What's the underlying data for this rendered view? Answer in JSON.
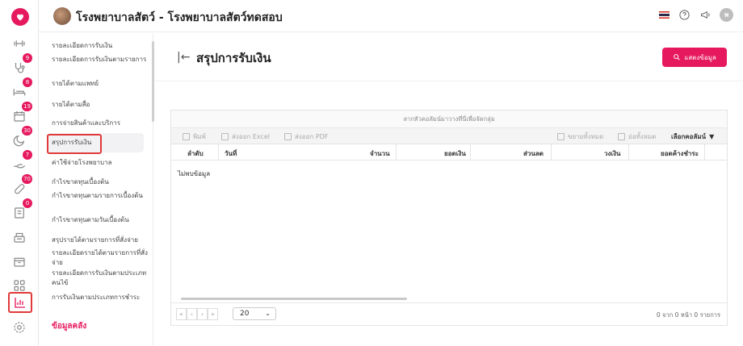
{
  "header": {
    "title": "โรงพยาบาลสัตว์ - โรงพยาบาลสัตว์ทดสอบ",
    "user_initial": "พ"
  },
  "rail": {
    "items": [
      {
        "icon": "dumbbell-icon",
        "badge": ""
      },
      {
        "icon": "stethoscope-icon",
        "badge": "9"
      },
      {
        "icon": "bed-icon",
        "badge": "8"
      },
      {
        "icon": "calendar-icon",
        "badge": "19"
      },
      {
        "icon": "moon-icon",
        "badge": "30"
      },
      {
        "icon": "hand-icon",
        "badge": "7"
      },
      {
        "icon": "pill-icon",
        "badge": "70"
      },
      {
        "icon": "document-icon",
        "badge": "0"
      },
      {
        "icon": "cashier-icon",
        "badge": ""
      },
      {
        "icon": "box-icon",
        "badge": ""
      },
      {
        "icon": "apps-icon",
        "badge": ""
      },
      {
        "icon": "report-chart-icon",
        "badge": ""
      },
      {
        "icon": "settings-icon",
        "badge": ""
      }
    ]
  },
  "submenu": {
    "items": [
      "รายละเอียดการรับเงิน",
      "รายละเอียดการรับเงินตามรายการ",
      "รายได้ตามแพทย์",
      "รายได้ตามสื่อ",
      "การจ่ายสินค้าและบริการ",
      "สรุปการรับเงิน",
      "ค่าใช้จ่ายโรงพยาบาล",
      "กำไรขาดทุนเบื้องต้น",
      "กำไรขาดทุนตามรายการเบื้องต้น",
      "กำไรขาดทุนตามวันเบื้องต้น",
      "สรุปรายได้ตามรายการที่สั่งจ่าย",
      "รายละเอียดรายได้ตามรายการที่สั่งจ่าย",
      "รายละเอียดการรับเงินตามประเภทคนไข้",
      "การรับเงินตามประเภทการชำระ"
    ],
    "section": "ข้อมูลคลัง"
  },
  "page": {
    "title": "สรุปการรับเงิน",
    "show_button": "แสดงข้อมูล"
  },
  "grid": {
    "group_hint": "ลากหัวคอลัมน์มาวางที่นี่เพื่อจัดกลุ่ม",
    "toolbar": {
      "print": "พิมพ์",
      "export_excel": "ส่งออก Excel",
      "export_pdf": "ส่งออก PDF",
      "expand_all": "ขยายทั้งหมด",
      "collapse_all": "ย่อทั้งหมด",
      "choose_columns": "เลือกคอลัมน์"
    },
    "columns": [
      "ลำดับ",
      "วันที่",
      "จำนวน",
      "ยอดเงิน",
      "ส่วนลด",
      "วงเงิน",
      "ยอดค้างชำระ"
    ],
    "empty": "ไม่พบข้อมูล",
    "page_size": "20",
    "page_info": "0 จาก 0 หน้า 0 รายการ"
  }
}
